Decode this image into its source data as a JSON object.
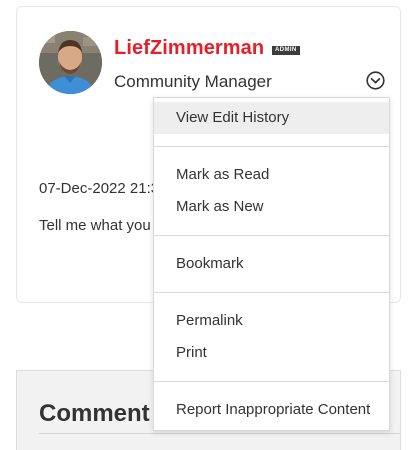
{
  "post": {
    "author": {
      "name": "LiefZimmerman",
      "badge": "ADMIN",
      "rank": "Community Manager",
      "colors": {
        "name": "#e5202a",
        "badge_bg": "#3d3d3d"
      }
    },
    "options_icon": "chevron-down-circle-icon",
    "date_visible": "07-Dec-2022 21:3",
    "body_visible": "Tell me what you"
  },
  "comment_panel": {
    "title_visible": "Comment"
  },
  "menu": {
    "items": [
      {
        "label": "View Edit History",
        "highlighted": true
      },
      {
        "label": "Mark as Read"
      },
      {
        "label": "Mark as New"
      },
      {
        "label": "Bookmark"
      },
      {
        "label": "Permalink"
      },
      {
        "label": "Print"
      },
      {
        "label": "Report Inappropriate Content"
      }
    ]
  }
}
